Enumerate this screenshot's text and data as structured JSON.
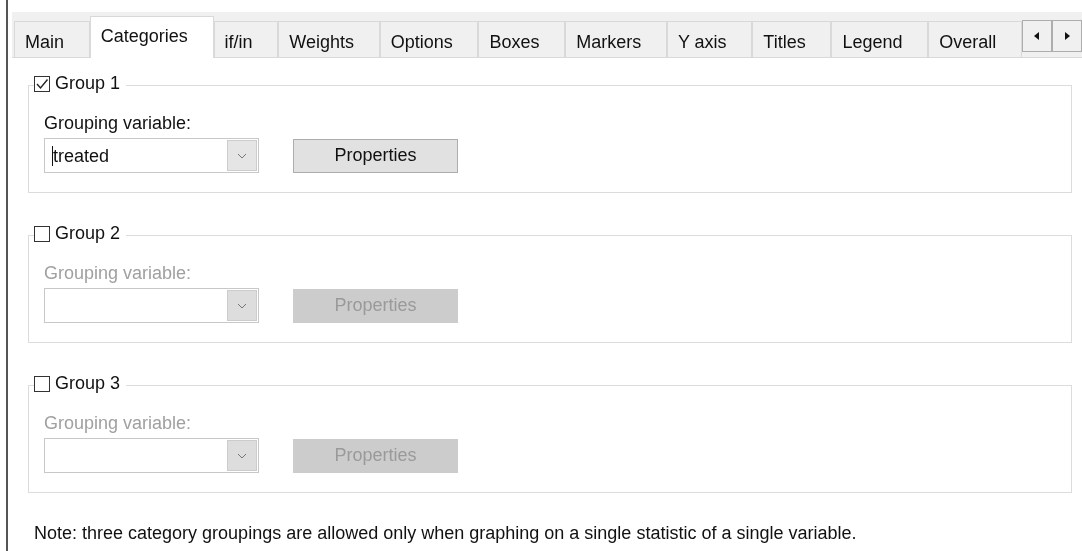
{
  "tabs": [
    {
      "label": "Main",
      "selected": false
    },
    {
      "label": "Categories",
      "selected": true
    },
    {
      "label": "if/in",
      "selected": false
    },
    {
      "label": "Weights",
      "selected": false
    },
    {
      "label": "Options",
      "selected": false
    },
    {
      "label": "Boxes",
      "selected": false
    },
    {
      "label": "Markers",
      "selected": false
    },
    {
      "label": "Y axis",
      "selected": false
    },
    {
      "label": "Titles",
      "selected": false
    },
    {
      "label": "Legend",
      "selected": false
    },
    {
      "label": "Overall",
      "selected": false
    }
  ],
  "groups": [
    {
      "label": "Group 1",
      "checked": true,
      "disabled": false,
      "field_label": "Grouping variable:",
      "value": "treated",
      "button": "Properties"
    },
    {
      "label": "Group 2",
      "checked": false,
      "disabled": true,
      "field_label": "Grouping variable:",
      "button": "Properties"
    },
    {
      "label": "Group 3",
      "checked": false,
      "disabled": true,
      "field_label": "Grouping variable:",
      "button": "Properties"
    }
  ],
  "note": "Note: three category groupings are allowed only when graphing on a single statistic of a single variable."
}
